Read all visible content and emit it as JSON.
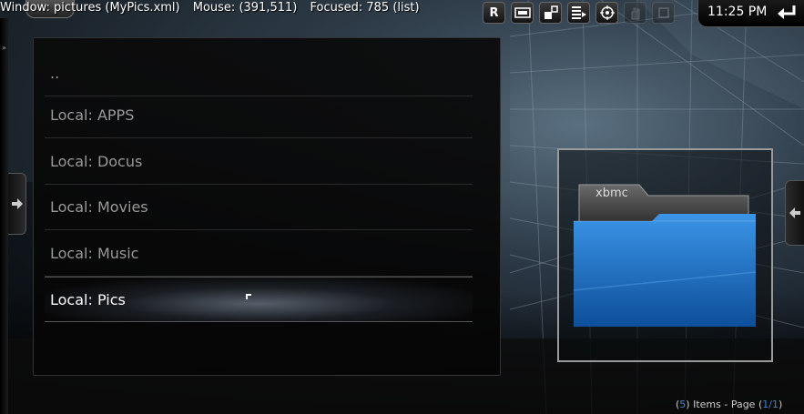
{
  "debug": {
    "window": "Window: pictures (MyPics.xml)",
    "mouse": "Mouse: (391,511)",
    "focused": "Focused: 785 (list)"
  },
  "toolbar": {
    "buttons": [
      {
        "label": "R",
        "icon": "reset-icon"
      },
      {
        "label": "",
        "icon": "display-icon"
      },
      {
        "label": "",
        "icon": "fullscreen-icon"
      },
      {
        "label": "",
        "icon": "playlist-icon"
      },
      {
        "label": "",
        "icon": "target-icon"
      },
      {
        "label": "",
        "icon": "hand-icon"
      },
      {
        "label": "",
        "icon": "stop-icon"
      }
    ]
  },
  "clock": "11:25 PM",
  "list": {
    "items": [
      {
        "label": ".."
      },
      {
        "label": "Local: APPS"
      },
      {
        "label": "Local: Docus"
      },
      {
        "label": "Local: Movies"
      },
      {
        "label": "Local: Music"
      },
      {
        "label": "Local: Pics"
      }
    ],
    "focused_index": 5
  },
  "thumbnail": {
    "folder_logo": "xbmc",
    "folder_color": "#1a6fc4"
  },
  "footer": {
    "open_paren": "(",
    "count": "5",
    "items_text": ") Items - Page (",
    "page": "1/1",
    "close_paren": ")"
  },
  "colors": {
    "accent_blue": "#4a7fd0",
    "focused_text": "#ffffff",
    "item_text": "#999999"
  }
}
